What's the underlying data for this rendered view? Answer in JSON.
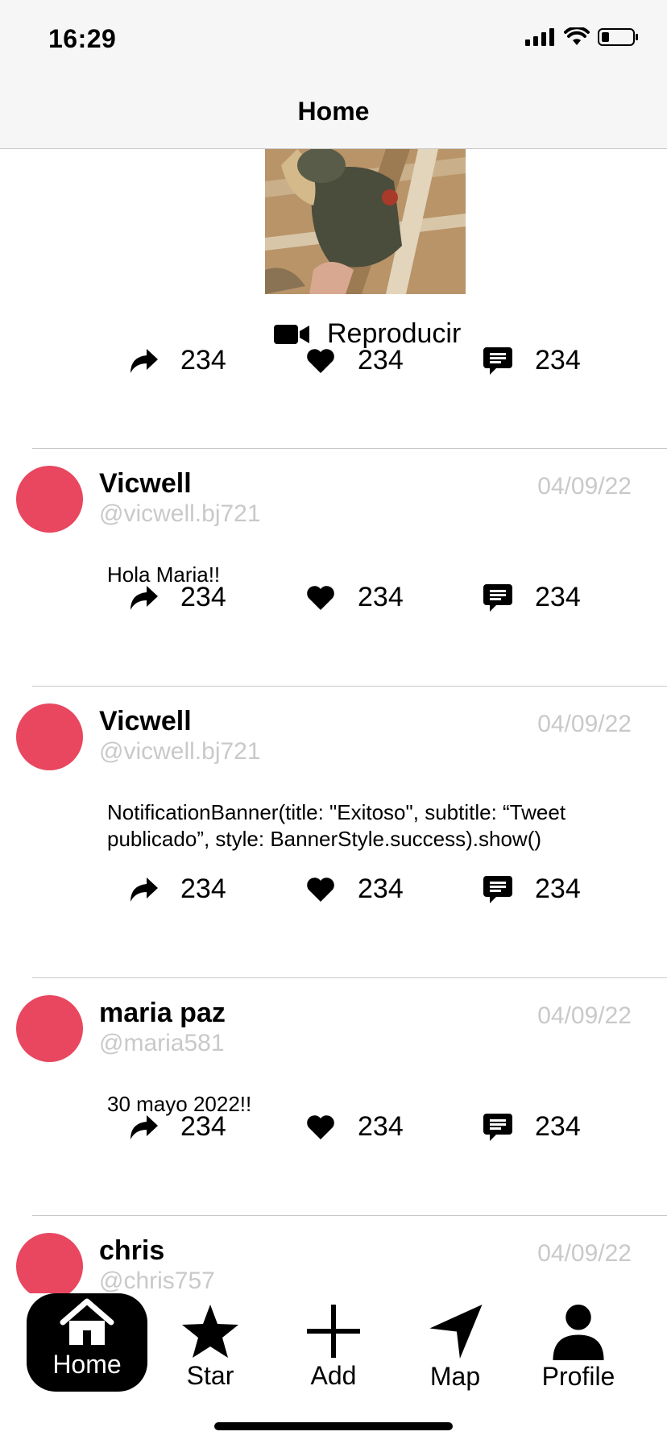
{
  "status_bar": {
    "time": "16:29"
  },
  "nav": {
    "title": "Home"
  },
  "media_post": {
    "play_label": "Reproducir",
    "share_count": "234",
    "like_count": "234",
    "comment_count": "234"
  },
  "posts": [
    {
      "name": "Vicwell",
      "handle": "@vicwell.bj721",
      "date": "04/09/22",
      "text": "Hola Maria!!",
      "share_count": "234",
      "like_count": "234",
      "comment_count": "234"
    },
    {
      "name": "Vicwell",
      "handle": "@vicwell.bj721",
      "date": "04/09/22",
      "text": "NotificationBanner(title: \"Exitoso\", subtitle: “Tweet publicado”, style: BannerStyle.success).show()",
      "share_count": "234",
      "like_count": "234",
      "comment_count": "234"
    },
    {
      "name": "maria paz",
      "handle": "@maria581",
      "date": "04/09/22",
      "text": "30 mayo 2022!!",
      "share_count": "234",
      "like_count": "234",
      "comment_count": "234"
    },
    {
      "name": "chris",
      "handle": "@chris757",
      "date": "04/09/22"
    }
  ],
  "tabs": [
    {
      "label": "Home",
      "icon": "home-icon",
      "active": true
    },
    {
      "label": "Star",
      "icon": "star-icon"
    },
    {
      "label": "Add",
      "icon": "plus-icon"
    },
    {
      "label": "Map",
      "icon": "location-arrow-icon"
    },
    {
      "label": "Profile",
      "icon": "person-icon"
    }
  ],
  "colors": {
    "avatar": "#e8475f",
    "muted_text": "#c9c9c9",
    "bar_bg": "#f6f6f6"
  }
}
